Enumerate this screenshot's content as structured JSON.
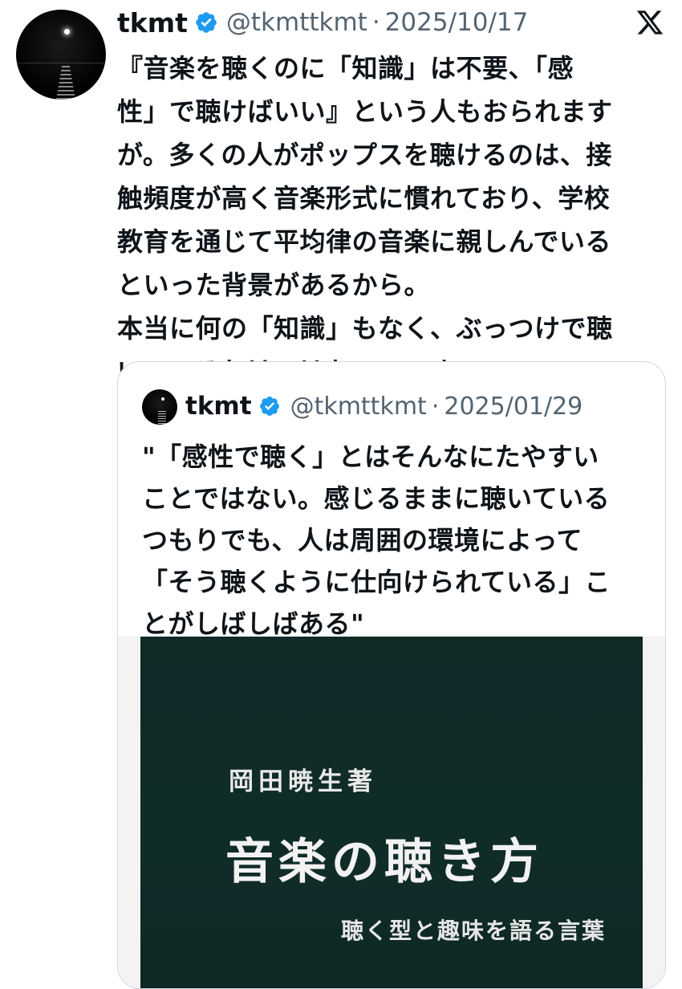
{
  "tweet": {
    "display_name": "tkmt",
    "handle": "@tkmttkmt",
    "separator": "·",
    "date": "2025/10/17",
    "verified_icon": "verified-badge-icon",
    "avatar_icon": "moon-over-sea-avatar",
    "platform_icon": "x-logo-icon",
    "text_lines": [
      "『音楽を聴くのに「知識」は不要、「感",
      "性」で聴けばいい』という人もおられます",
      "が。多くの人がポップスを聴けるのは、接",
      "触頻度が高く音楽形式に慣れており、学校",
      "教育を通じて平均律の音楽に親しんでいる",
      "といった背景があるから。",
      "本当に何の「知識」もなく、ぶっつけで聴",
      "いているわけではないのです。"
    ]
  },
  "quoted_tweet": {
    "display_name": "tkmt",
    "handle": "@tkmttkmt",
    "separator": "·",
    "date": "2025/01/29",
    "text_lines": [
      "\"「感性で聴く」とはそんなにたやすい",
      "ことではない。感じるままに聴いている",
      "つもりでも、人は周囲の環境によって",
      "「そう聴くように仕向けられている」こ",
      "とがしばしばある\""
    ],
    "book": {
      "author": "岡田暁生著",
      "title": "音楽の聴き方",
      "subtitle": "聴く型と趣味を語る言葉"
    }
  },
  "colors": {
    "text_primary": "#0f1419",
    "text_secondary": "#536471",
    "verified_blue": "#1d9bf0",
    "card_border": "#cfd9de",
    "book_cover": "#0f2a27"
  }
}
